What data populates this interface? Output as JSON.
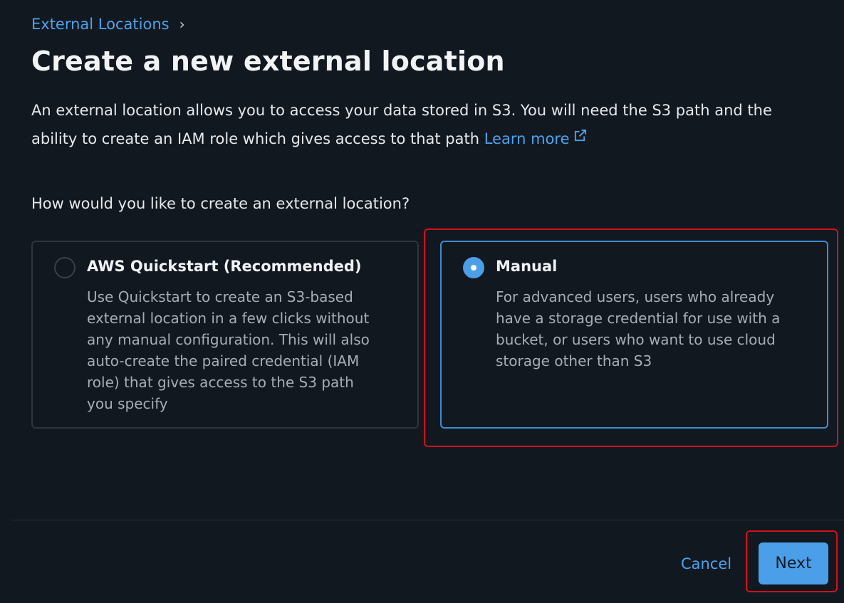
{
  "breadcrumb": {
    "parent": "External Locations",
    "separator": "›"
  },
  "page": {
    "title": "Create a new external location",
    "description": "An external location allows you to access your data stored in S3. You will need the S3 path and the ability to create an IAM role which gives access to that path",
    "learn_more": "Learn more",
    "question": "How would you like to create an external location?"
  },
  "options": [
    {
      "title": "AWS Quickstart (Recommended)",
      "description": "Use Quickstart to create an S3-based external location in a few clicks without any manual configuration. This will also auto-create the paired credential (IAM role) that gives access to the S3 path you specify",
      "selected": false
    },
    {
      "title": "Manual",
      "description": "For advanced users, users who already have a storage credential for use with a bucket, or users who want to use cloud storage other than S3",
      "selected": true
    }
  ],
  "footer": {
    "cancel_label": "Cancel",
    "next_label": "Next"
  },
  "colors": {
    "background": "#121820",
    "accent": "#4a9fe8",
    "link": "#4aa3ec",
    "highlight": "#d0131b"
  },
  "icons": {
    "breadcrumb_separator": "chevron-right-icon",
    "learn_more": "external-link-icon"
  }
}
